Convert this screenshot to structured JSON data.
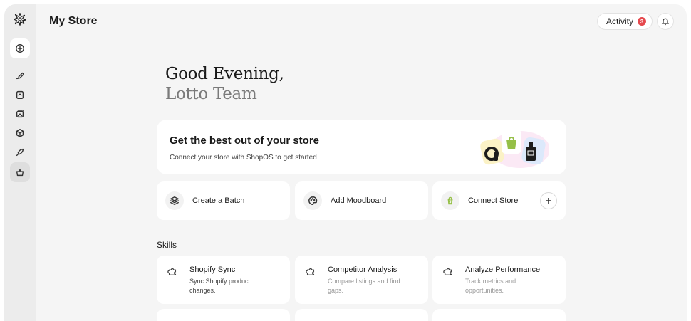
{
  "header": {
    "title": "My Store",
    "activity_label": "Activity",
    "activity_count": "3"
  },
  "sidebar": {
    "items": [
      {
        "name": "new-icon"
      },
      {
        "name": "brush-icon"
      },
      {
        "name": "clipboard-icon"
      },
      {
        "name": "gallery-icon"
      },
      {
        "name": "box-icon"
      },
      {
        "name": "rocket-icon"
      },
      {
        "name": "basket-icon"
      }
    ]
  },
  "greeting": {
    "line1": "Good Evening,",
    "line2": "Lotto Team"
  },
  "hero": {
    "title": "Get the best out of your store",
    "subtitle": "Connect your store with ShopOS to get started"
  },
  "actions": [
    {
      "label": "Create a Batch",
      "icon": "layers-icon"
    },
    {
      "label": "Add Moodboard",
      "icon": "palette-icon"
    },
    {
      "label": "Connect Store",
      "icon": "shopify-icon"
    }
  ],
  "skills": {
    "heading": "Skills",
    "items": [
      {
        "title": "Shopify Sync",
        "desc": "Sync Shopify product changes."
      },
      {
        "title": "Competitor Analysis",
        "desc": "Compare listings and find gaps."
      },
      {
        "title": "Analyze Performance",
        "desc": "Track metrics and opportunities."
      }
    ]
  },
  "colors": {
    "accent_badge": "#e5484d",
    "shopify_green": "#95bf47",
    "background": "#f5f5f5"
  }
}
